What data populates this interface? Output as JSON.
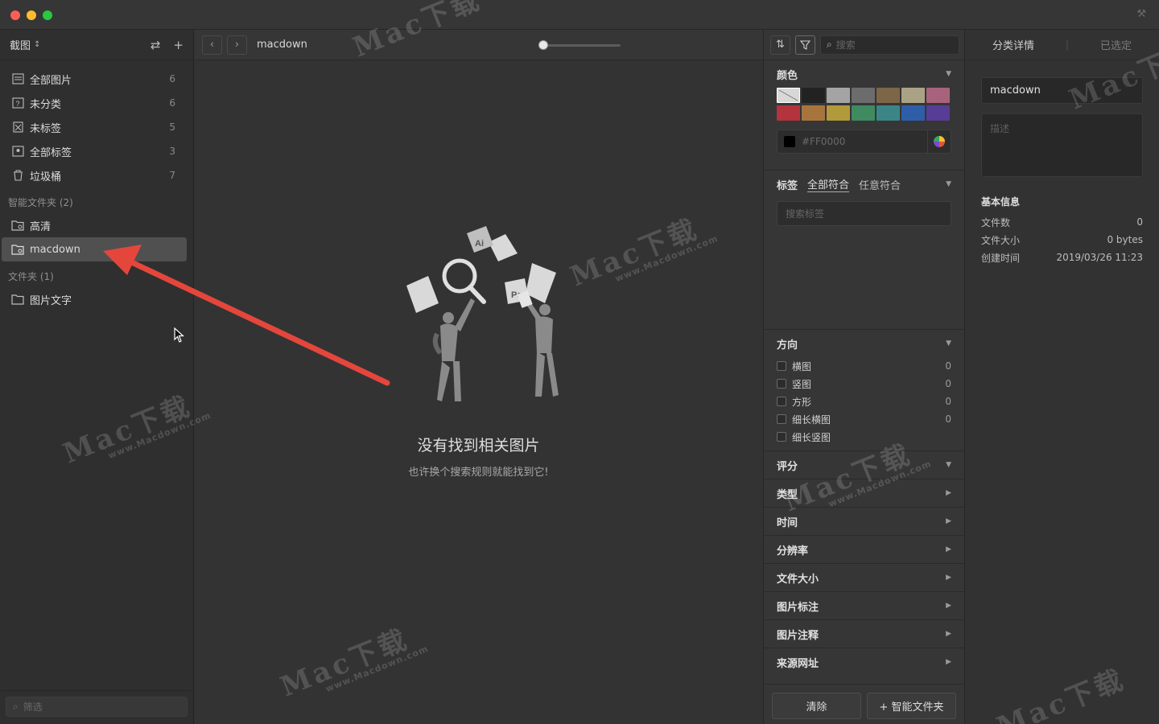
{
  "sidebar": {
    "library": "截图",
    "items": [
      {
        "label": "全部图片",
        "count": "6",
        "icon": "all-images-icon"
      },
      {
        "label": "未分类",
        "count": "6",
        "icon": "uncategorized-icon"
      },
      {
        "label": "未标签",
        "count": "5",
        "icon": "untagged-icon"
      },
      {
        "label": "全部标签",
        "count": "3",
        "icon": "all-tags-icon"
      },
      {
        "label": "垃圾桶",
        "count": "7",
        "icon": "trash-icon"
      }
    ],
    "smart_section": "智能文件夹 (2)",
    "smart_folders": [
      {
        "label": "高清"
      },
      {
        "label": "macdown"
      }
    ],
    "folder_section": "文件夹 (1)",
    "folders": [
      {
        "label": "图片文字"
      }
    ],
    "filter_placeholder": "筛选"
  },
  "main": {
    "breadcrumb": "macdown",
    "empty_title": "没有找到相关图片",
    "empty_subtitle": "也许换个搜索规则就能找到它!",
    "illustration_labels": {
      "ai": "Ai",
      "ps": "Ps"
    }
  },
  "filter": {
    "search_placeholder": "搜索",
    "color_title": "颜色",
    "swatches": [
      "none",
      "#222222",
      "#a4a4a4",
      "#6c6c6c",
      "#7d6548",
      "#aaa285",
      "#a8637c",
      "#b3343c",
      "#a8743e",
      "#b19a3c",
      "#3f8a61",
      "#3c8587",
      "#2f5ea9",
      "#583d96"
    ],
    "hex_placeholder": "#FF0000",
    "tags_title": "标签",
    "tags_tab_all": "全部符合",
    "tags_tab_any": "任意符合",
    "tags_search_placeholder": "搜索标签",
    "orientation_title": "方向",
    "orientation": [
      {
        "label": "横图",
        "count": "0"
      },
      {
        "label": "竖图",
        "count": "0"
      },
      {
        "label": "方形",
        "count": "0"
      },
      {
        "label": "细长横图",
        "count": "0"
      },
      {
        "label": "细长竖图",
        "count": ""
      }
    ],
    "rating_title": "评分",
    "sections": [
      "类型",
      "时间",
      "分辨率",
      "文件大小",
      "图片标注",
      "图片注释",
      "来源网址"
    ],
    "clear_label": "清除",
    "smart_folder_label": "+ 智能文件夹"
  },
  "inspector": {
    "tab_detail": "分类详情",
    "tab_selected": "已选定",
    "name_value": "macdown",
    "desc_placeholder": "描述",
    "info_title": "基本信息",
    "info": [
      {
        "key": "文件数",
        "value": "0"
      },
      {
        "key": "文件大小",
        "value": "0 bytes"
      },
      {
        "key": "创建时间",
        "value": "2019/03/26 11:23"
      }
    ]
  },
  "watermark": {
    "brand": "Mac下载",
    "url": "www.Macdown.com"
  }
}
